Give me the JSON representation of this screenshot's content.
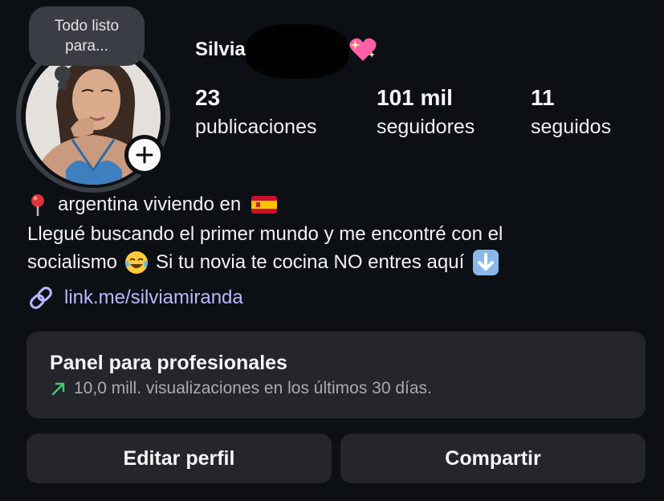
{
  "note": {
    "line1": "Todo listo",
    "line2": "para..."
  },
  "profile": {
    "username": "Silvia",
    "name_emoji": "sparkling-heart-emoji"
  },
  "stats": [
    {
      "value": "23",
      "label": "publicaciones"
    },
    {
      "value": "101 mil",
      "label": "seguidores"
    },
    {
      "value": "11",
      "label": "seguidos"
    }
  ],
  "bio": {
    "line1": "argentina viviendo en",
    "line2": "Llegué buscando el primer mundo y me encontré con el",
    "line3a": "socialismo",
    "line3b": "Si tu novia te cocina NO entres aquí",
    "link": "link.me/silviamiranda"
  },
  "panel": {
    "title": "Panel para profesionales",
    "subtitle": "10,0 mill. visualizaciones en los últimos 30 días."
  },
  "buttons": {
    "edit": "Editar perfil",
    "share": "Compartir"
  },
  "colors": {
    "background": "#0c0f14",
    "card": "#24262c",
    "link": "#b9b8ff",
    "trend": "#3ecb6b"
  }
}
